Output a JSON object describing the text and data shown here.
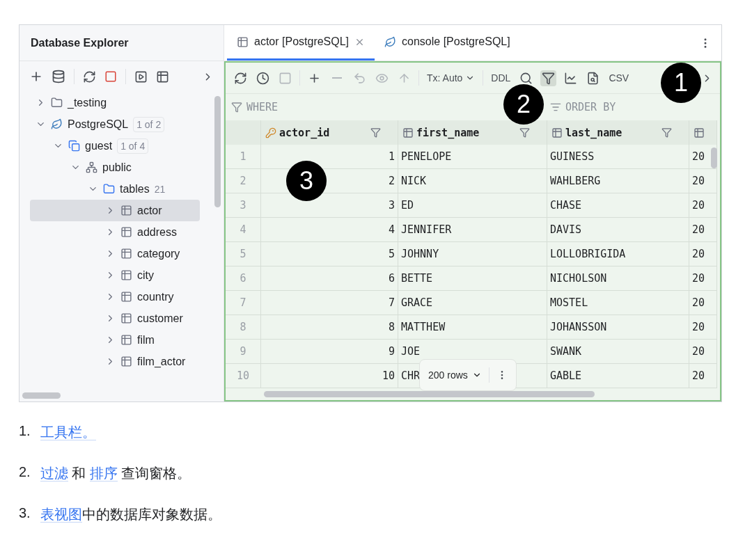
{
  "explorer": {
    "title": "Database Explorer",
    "tree": [
      {
        "label": "_testing",
        "kind": "folder",
        "expanded": false,
        "selected": false
      },
      {
        "label": "PostgreSQL",
        "kind": "postgres",
        "expanded": true,
        "selected": false,
        "badge": "1 of 2",
        "children": [
          {
            "label": "guest",
            "kind": "database",
            "expanded": true,
            "selected": false,
            "badge": "1 of 4",
            "children": [
              {
                "label": "public",
                "kind": "schema",
                "expanded": true,
                "selected": false,
                "children": [
                  {
                    "label": "tables",
                    "kind": "table-folder",
                    "expanded": true,
                    "selected": false,
                    "count": "21",
                    "children": [
                      {
                        "label": "actor",
                        "kind": "table",
                        "expanded": false,
                        "selected": true
                      },
                      {
                        "label": "address",
                        "kind": "table",
                        "expanded": false,
                        "selected": false
                      },
                      {
                        "label": "category",
                        "kind": "table",
                        "expanded": false,
                        "selected": false
                      },
                      {
                        "label": "city",
                        "kind": "table",
                        "expanded": false,
                        "selected": false
                      },
                      {
                        "label": "country",
                        "kind": "table",
                        "expanded": false,
                        "selected": false
                      },
                      {
                        "label": "customer",
                        "kind": "table",
                        "expanded": false,
                        "selected": false
                      },
                      {
                        "label": "film",
                        "kind": "table",
                        "expanded": false,
                        "selected": false
                      },
                      {
                        "label": "film_actor",
                        "kind": "table",
                        "expanded": false,
                        "selected": false
                      }
                    ]
                  }
                ]
              }
            ]
          }
        ]
      }
    ]
  },
  "tabs": [
    {
      "label": "actor [PostgreSQL]",
      "kind": "table",
      "selected": true,
      "closable": true
    },
    {
      "label": "console [PostgreSQL]",
      "kind": "postgres",
      "selected": false,
      "closable": false
    }
  ],
  "toolbar": [
    {
      "kind": "refresh",
      "disabled": false,
      "selected": false
    },
    {
      "kind": "history",
      "disabled": false,
      "selected": false
    },
    {
      "kind": "stop",
      "disabled": true,
      "selected": false
    },
    {
      "kind": "separator"
    },
    {
      "kind": "add",
      "disabled": false,
      "selected": false
    },
    {
      "kind": "remove",
      "disabled": true,
      "selected": false
    },
    {
      "kind": "revert",
      "disabled": true,
      "selected": false
    },
    {
      "kind": "preview",
      "disabled": true,
      "selected": false
    },
    {
      "kind": "submit",
      "disabled": true,
      "selected": false
    },
    {
      "kind": "separator"
    },
    {
      "kind": "dropdown",
      "label": "Tx: Auto",
      "disabled": false,
      "selected": false
    },
    {
      "kind": "separator"
    },
    {
      "kind": "text",
      "label": "DDL",
      "disabled": false,
      "selected": false
    },
    {
      "kind": "search",
      "disabled": false,
      "selected": false
    },
    {
      "kind": "filter",
      "disabled": false,
      "selected": true
    },
    {
      "kind": "chart",
      "disabled": false,
      "selected": false
    },
    {
      "kind": "viewer",
      "disabled": false,
      "selected": false
    },
    {
      "kind": "text",
      "label": "CSV",
      "disabled": false,
      "selected": false
    }
  ],
  "filter": {
    "where": "WHERE",
    "order_by": "ORDER BY"
  },
  "columns": [
    {
      "name": "actor_id",
      "key": true
    },
    {
      "name": "first_name",
      "key": false
    },
    {
      "name": "last_name",
      "key": false
    },
    {
      "key": false
    }
  ],
  "rows": [
    {
      "number": "1",
      "cells": [
        "1",
        "PENELOPE",
        "GUINESS",
        "20"
      ]
    },
    {
      "number": "2",
      "cells": [
        "2",
        "NICK",
        "WAHLBERG",
        "20"
      ]
    },
    {
      "number": "3",
      "cells": [
        "3",
        "ED",
        "CHASE",
        "20"
      ]
    },
    {
      "number": "4",
      "cells": [
        "4",
        "JENNIFER",
        "DAVIS",
        "20"
      ]
    },
    {
      "number": "5",
      "cells": [
        "5",
        "JOHNNY",
        "LOLLOBRIGIDA",
        "20"
      ]
    },
    {
      "number": "6",
      "cells": [
        "6",
        "BETTE",
        "NICHOLSON",
        "20"
      ]
    },
    {
      "number": "7",
      "cells": [
        "7",
        "GRACE",
        "MOSTEL",
        "20"
      ]
    },
    {
      "number": "8",
      "cells": [
        "8",
        "MATTHEW",
        "JOHANSSON",
        "20"
      ]
    },
    {
      "number": "9",
      "cells": [
        "9",
        "JOE",
        "SWANK",
        "20"
      ]
    },
    {
      "number": "10",
      "cells": [
        "10",
        "CHR",
        "GABLE",
        "20"
      ]
    }
  ],
  "pager": "200 rows",
  "callouts": [
    "1",
    "2",
    "3"
  ],
  "notes": [
    {
      "number": "1.",
      "parts": [
        {
          "text": "工具栏。",
          "link": true
        }
      ]
    },
    {
      "number": "2.",
      "parts": [
        {
          "text": "过滤",
          "link": true
        },
        {
          "text": " 和 ",
          "link": false
        },
        {
          "text": "排序",
          "link": true
        },
        {
          "text": " 查询窗格。",
          "link": false
        }
      ]
    },
    {
      "number": "3.",
      "parts": [
        {
          "text": "表视图",
          "link": true
        },
        {
          "text": "中的数据库对象数据。",
          "link": false
        }
      ]
    }
  ]
}
